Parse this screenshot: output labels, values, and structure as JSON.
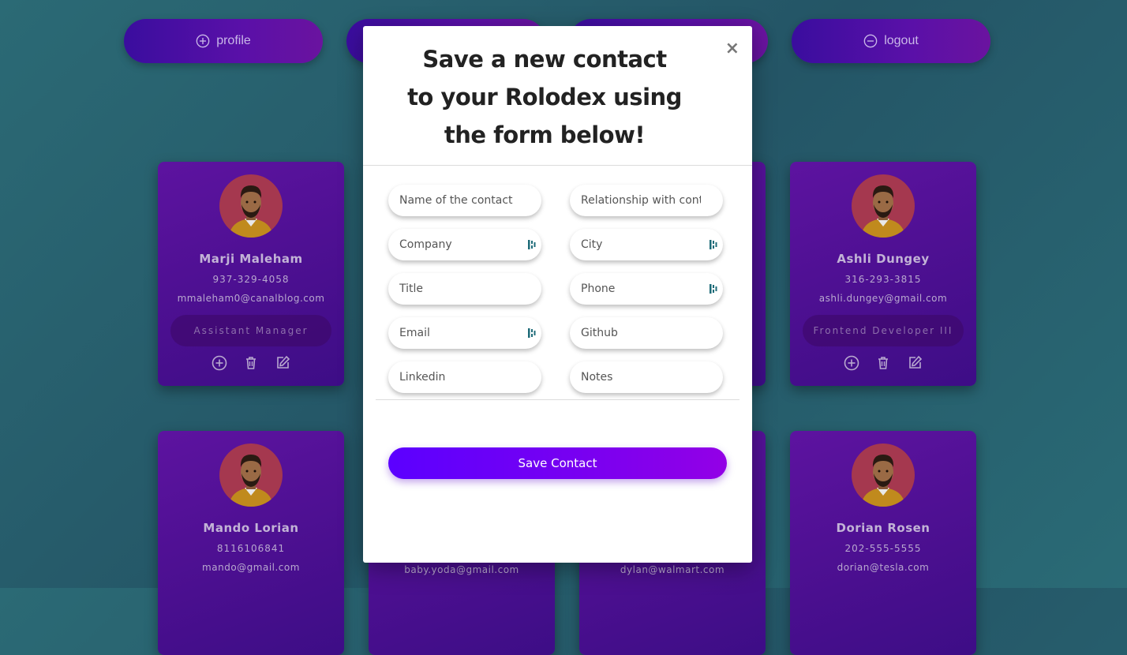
{
  "nav": {
    "profile_label": "profile",
    "logout_label": "logout"
  },
  "cards": [
    {
      "name": "Marji Maleham",
      "phone": "937-329-4058",
      "email": "mmaleham0@canalblog.com",
      "role": "Assistant Manager"
    },
    {
      "name": "Ashli Dungey",
      "phone": "316-293-3815",
      "email": "ashli.dungey@gmail.com",
      "role": "Frontend Developer III"
    },
    {
      "name": "Mando Lorian",
      "phone": "8116106841",
      "email": "mando@gmail.com",
      "role": ""
    },
    {
      "name": "",
      "phone": "",
      "email": "baby.yoda@gmail.com",
      "role": ""
    },
    {
      "name": "",
      "phone": "",
      "email": "dylan@walmart.com",
      "role": ""
    },
    {
      "name": "Dorian Rosen",
      "phone": "202-555-5555",
      "email": "dorian@tesla.com",
      "role": ""
    }
  ],
  "modal": {
    "title": "Save a new contact to your Rolodex using the form below!",
    "close_symbol": "×",
    "fields": {
      "name": "Name of the contact",
      "relationship": "Relationship with contac",
      "company": "Company",
      "city": "City",
      "title": "Title",
      "phone": "Phone",
      "email": "Email",
      "github": "Github",
      "linkedin": "Linkedin",
      "notes": "Notes"
    },
    "save_label": "Save Contact"
  },
  "colors": {
    "background": "#26606d",
    "card": "#5d13a0",
    "accent": "#6a00ff"
  }
}
